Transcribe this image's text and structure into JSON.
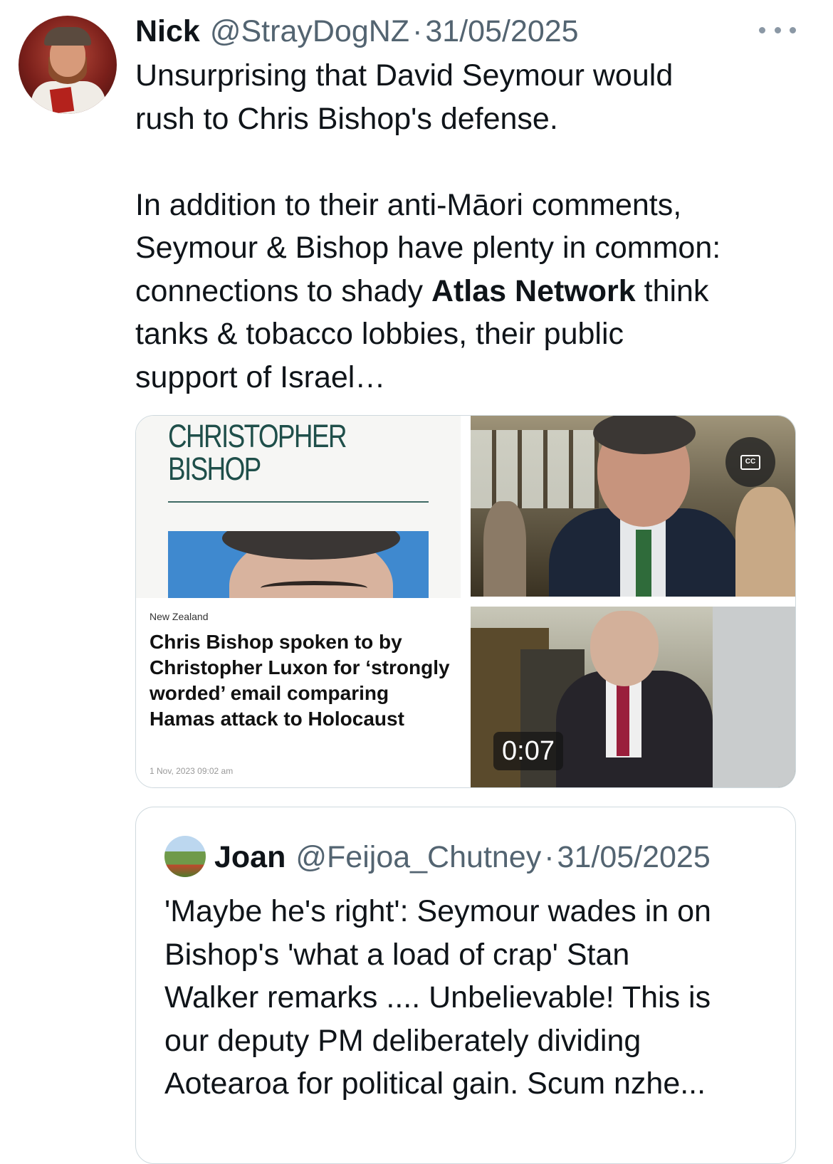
{
  "tweet": {
    "author_name": "Nick",
    "handle": "@StrayDogNZ",
    "separator": "·",
    "date": "31/05/2025",
    "text_part1": "Unsurprising that David Seymour would\nrush to Chris Bishop's defense.\n\nIn addition to their anti-Māori comments,\nSeymour & Bishop have plenty in common:\nconnections to shady ",
    "text_bold": "Atlas Network",
    "text_part2": " think\ntanks & tobacco lobbies, their public\nsupport of Israel…",
    "more_icon": "more-horizontal-icon"
  },
  "media": {
    "article": {
      "title": "CHRISTOPHER\nBISHOP",
      "section": "New Zealand",
      "headline": "Chris Bishop spoken to by Christopher Luxon for ‘strongly worded’ email comparing Hamas attack to Holocaust",
      "date": "1 Nov, 2023 09:02 am"
    },
    "video_top": {
      "cc_label": "CC",
      "cc_icon": "closed-captions-icon"
    },
    "video_bottom": {
      "duration": "0:07"
    }
  },
  "quoted_tweet": {
    "author_name": "Joan",
    "handle": "@Feijoa_Chutney",
    "separator": "·",
    "date": "31/05/2025",
    "text": "'Maybe he's right': Seymour wades in on\nBishop's 'what a load of crap' Stan\nWalker remarks .... Unbelievable! This is\nour deputy PM deliberately dividing\nAotearoa for political gain. Scum  nzhe..."
  },
  "colors": {
    "text_primary": "#0f1419",
    "text_secondary": "#536471",
    "border": "#cfd9de",
    "article_title": "#1f4f4a"
  }
}
